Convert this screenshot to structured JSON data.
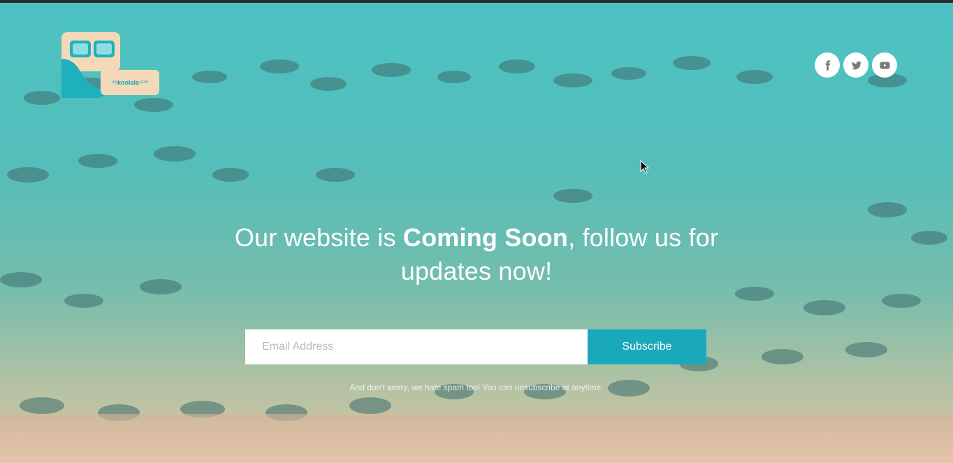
{
  "brand": {
    "logo_prefix": "my",
    "logo_name": "koolala",
    "logo_suffix": ".com"
  },
  "social": [
    {
      "icon": "facebook-icon"
    },
    {
      "icon": "twitter-icon"
    },
    {
      "icon": "youtube-icon"
    }
  ],
  "hero": {
    "heading_start": "Our website is ",
    "heading_bold": "Coming Soon",
    "heading_end": ", follow us for updates now!"
  },
  "subscribe_form": {
    "email_placeholder": "Email Address",
    "email_value": "",
    "button_label": "Subscribe",
    "note": "And don't worry, we hate spam too! You can unsubscribe at anytime."
  },
  "colors": {
    "accent": "#1aa9ba",
    "overlay_teal": "#4ac4c4",
    "logo_sand": "#f3d9b8"
  }
}
